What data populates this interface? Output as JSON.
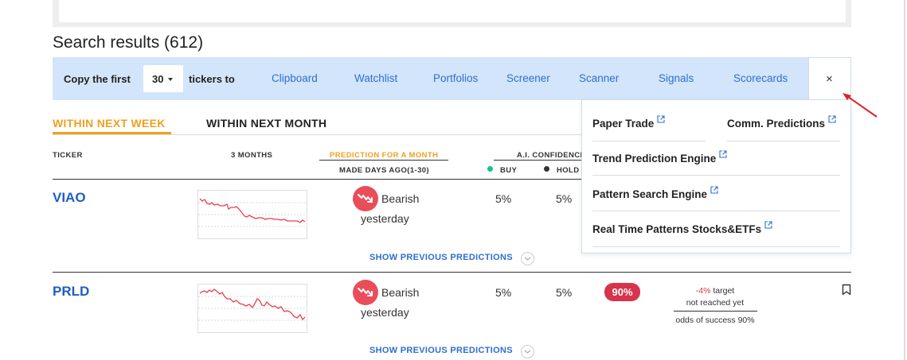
{
  "results": {
    "title": "Search results (612)"
  },
  "copybar": {
    "prefix": "Copy the first",
    "count": "30",
    "suffix": "tickers to",
    "links": [
      "Clipboard",
      "Watchlist",
      "Portfolios",
      "Screener",
      "Scanner",
      "Signals",
      "Scorecards"
    ],
    "close": "×"
  },
  "tabs": {
    "active": "WITHIN NEXT WEEK",
    "inactive": "WITHIN NEXT MONTH"
  },
  "columns": {
    "ticker": "TICKER",
    "months": "3 MONTHS",
    "prediction": "PREDICTION FOR A MONTH",
    "made": "MADE DAYS AGO(1-30)",
    "confidence": "A.I. CONFIDENCE",
    "buy": "BUY",
    "hold": "HOLD"
  },
  "rows": [
    {
      "ticker": "VIAO",
      "prediction": "Bearish",
      "when": "yesterday",
      "buy": "5%",
      "hold": "5%",
      "show_prev": "SHOW PREVIOUS PREDICTIONS"
    },
    {
      "ticker": "PRLD",
      "prediction": "Bearish",
      "when": "yesterday",
      "buy": "5%",
      "hold": "5%",
      "odds_badge": "90%",
      "target_pct": "-4%",
      "target_word": "target",
      "target_status": "not reached yet",
      "odds_text": "odds of success 90%",
      "show_prev": "SHOW PREVIOUS PREDICTIONS"
    }
  ],
  "dropdown": {
    "items": [
      "Paper Trade",
      "Comm. Predictions",
      "Trend Prediction Engine",
      "Pattern Search Engine",
      "Real Time Patterns Stocks&ETFs"
    ]
  },
  "colors": {
    "accent_blue": "#2e6ecf",
    "ticker_blue": "#1f5fc1",
    "orange": "#f0a020",
    "bearish_red": "#ea4d5a",
    "bar_bg": "#d3e5fb",
    "buy_dot": "#19c38a"
  },
  "icons": [
    "external-link-icon",
    "close-icon",
    "bookmark-icon",
    "chevron-down-icon",
    "bearish-trend-icon",
    "caret-down-icon",
    "annotation-arrow"
  ]
}
